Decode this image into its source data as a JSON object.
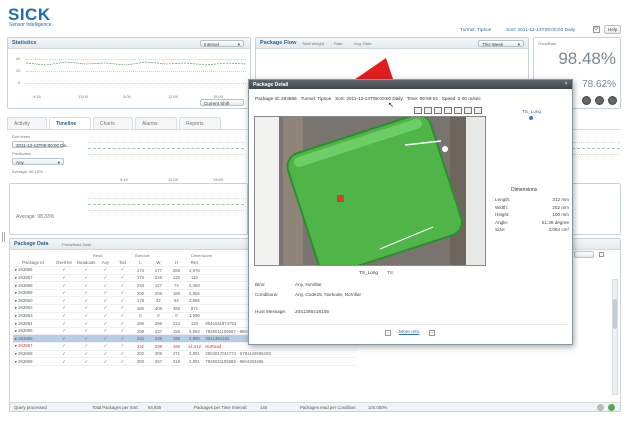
{
  "brand": {
    "logo": "SICK",
    "tagline": "Sensor Intelligence.",
    "color": "#1f6fb0"
  },
  "header": {
    "link1": "Tunnel: Tipsoe",
    "link2": "Sort: 2011-12-13T09:00:00 Daily",
    "link3": "Help"
  },
  "statistics": {
    "title": "Statistics",
    "dropdown": "Interval",
    "y_ticks": [
      "40",
      "20",
      "0"
    ],
    "x_ticks": [
      "9:15",
      "13:00",
      "9:00",
      "12:00",
      "15:00"
    ],
    "button": "Current Shift"
  },
  "package_flow": {
    "title": "Package Flow",
    "subtabs": [
      "Total Weight",
      "Rate",
      "Avg. Rate"
    ],
    "dropdown": "This Week"
  },
  "kpi": {
    "label1": "GoodRate",
    "value1": "98.48%",
    "value2": "78.62%"
  },
  "tabs": [
    "Activity",
    "Timeline",
    "Charts",
    "Alarms",
    "Reports"
  ],
  "filter": {
    "label1": "Sort times",
    "value1": "2011-12-13T09:00:00 Da...",
    "label2": "Predicates",
    "value2": "Any",
    "avg_label": "Average:",
    "avg_value": "98.18%"
  },
  "summary": {
    "avg_label": "Average:",
    "avg_value": "98.33%"
  },
  "package_data": {
    "tabs": [
      "Package Data",
      "Predefined Data"
    ],
    "group_headers": {
      "read": "Read",
      "barcode": "Barcode",
      "dims": "Dimensions"
    },
    "columns": [
      "Package Id",
      "OverHer",
      "Readouts",
      "Any",
      "Tod",
      "L",
      "W",
      "H",
      "Res",
      ""
    ],
    "rows": [
      {
        "id": "263856",
        "c": [
          "✓",
          "✓",
          "✓",
          "✓"
        ],
        "l": "174",
        "w": "277",
        "h": "286",
        "r": "2,876",
        "code": "",
        "cls": ""
      },
      {
        "id": "263857",
        "c": [
          "✓",
          "✓",
          "✓",
          "✓"
        ],
        "l": "174",
        "w": "226",
        "h": "133",
        "r": "115",
        "code": "",
        "cls": ""
      },
      {
        "id": "263858",
        "c": [
          "✓",
          "✓",
          "✓",
          "✓"
        ],
        "l": "233",
        "w": "127",
        "h": "74",
        "r": "2,363",
        "code": "",
        "cls": ""
      },
      {
        "id": "263859",
        "c": [
          "✓",
          "✓",
          "✓",
          "✓"
        ],
        "l": "200",
        "w": "206",
        "h": "186",
        "r": "2,856",
        "code": "",
        "cls": ""
      },
      {
        "id": "263860",
        "c": [
          "✓",
          "✓",
          "✓",
          "✓"
        ],
        "l": "178",
        "w": "32",
        "h": "64",
        "r": "2,856",
        "code": "",
        "cls": ""
      },
      {
        "id": "263862",
        "c": [
          "✓",
          "✓",
          "✓",
          "✓"
        ],
        "l": "180",
        "w": "406",
        "h": "459",
        "r": "871",
        "code": "",
        "cls": ""
      },
      {
        "id": "263863",
        "c": [
          "✓",
          "✓",
          "✓",
          "✓"
        ],
        "l": "0",
        "w": "0",
        "h": "0",
        "r": "1,596",
        "code": "",
        "cls": ""
      },
      {
        "id": "263864",
        "c": [
          "✓",
          "✓",
          "✓",
          "✓"
        ],
        "l": "186",
        "w": "296",
        "h": "214",
        "r": "120",
        "code": "8541611874753",
        "cls": ""
      },
      {
        "id": "263865",
        "c": [
          "✓",
          "✓",
          "✓",
          "✓"
        ],
        "l": "299",
        "w": "237",
        "h": "156",
        "r": "5,863",
        "code": "7836011106587 - 8604303456",
        "cls": ""
      },
      {
        "id": "263866",
        "c": [
          "✓",
          "✓",
          "✓",
          "✓"
        ],
        "l": "232",
        "w": "239",
        "h": "195",
        "r": "2,800",
        "code": "3041384183",
        "cls": "sel"
      },
      {
        "id": "263867",
        "c": [
          "✓",
          "✓",
          "✓",
          "✓"
        ],
        "l": "232",
        "w": "299",
        "h": "190",
        "r": "14,312",
        "code": "NoRead",
        "cls": "red"
      },
      {
        "id": "263868",
        "c": [
          "✓",
          "✓",
          "✓",
          "✓"
        ],
        "l": "202",
        "w": "309",
        "h": "471",
        "r": "2,801",
        "code": "2504017011774 - 5781144655403",
        "cls": ""
      },
      {
        "id": "263869",
        "c": [
          "✓",
          "✓",
          "✓",
          "✓"
        ],
        "l": "300",
        "w": "257",
        "h": "318",
        "r": "2,801",
        "code": "7836011106588 - 8604303456",
        "cls": ""
      }
    ]
  },
  "status_bar": {
    "item1": "Query processed",
    "item2": "Total Packages per Sort:",
    "item2_val": "84,935",
    "item3": "Packages per Time Interval:",
    "item3_val": "140",
    "item4": "Packages read per Condition:",
    "item4_val": "100.000%"
  },
  "dialog": {
    "title": "Package Detail",
    "info": {
      "pkg": "Package Id: 263866",
      "tunnel": "Tunnel: Tipsoe",
      "sort": "Sort: 2011-12-13T09:00:00 Daily",
      "time": "Time: 09:59:04",
      "speed": "Speed: 2.00 m/sec"
    },
    "legend": "TS_Long",
    "image_tabs": [
      "TS_Long",
      "TS"
    ],
    "dims_title": "Dimensions",
    "dims": [
      [
        "Length:",
        "312 mm"
      ],
      [
        "Width:",
        "252 mm"
      ],
      [
        "Height:",
        "100 mm"
      ],
      [
        "Angle:",
        "51.38 degree"
      ],
      [
        "Size:",
        "2,064 cm³"
      ]
    ],
    "fields": [
      [
        "Bins:",
        "Any, NoVillar"
      ],
      [
        "Conditions:",
        "Any, Code25, Norkode, NoVillar"
      ],
      [
        "Host Message:",
        "2041386418138"
      ]
    ],
    "footer": "More Info"
  }
}
